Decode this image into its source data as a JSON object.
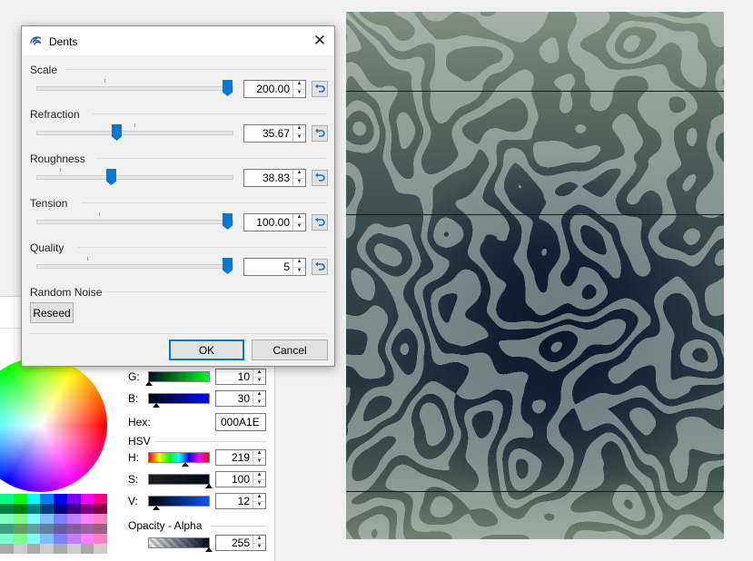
{
  "dialog": {
    "title": "Dents",
    "close_glyph": "✕",
    "params": [
      {
        "label": "Scale",
        "value": "200.00",
        "level": 1.0
      },
      {
        "label": "Refraction",
        "value": "35.67",
        "level": 0.42
      },
      {
        "label": "Roughness",
        "value": "38.83",
        "level": 0.39
      },
      {
        "label": "Tension",
        "value": "100.00",
        "level": 1.0
      },
      {
        "label": "Quality",
        "value": "5",
        "level": 1.0
      }
    ],
    "random_noise_label": "Random Noise",
    "reseed_label": "Reseed",
    "ok_label": "OK",
    "cancel_label": "Cancel",
    "accent_color": "#0078d7"
  },
  "colors": {
    "g": {
      "label": "G:",
      "value": "10"
    },
    "b": {
      "label": "B:",
      "value": "30"
    },
    "hex": {
      "label": "Hex:",
      "value": "000A1E"
    },
    "hsv_label": "HSV",
    "h": {
      "label": "H:",
      "value": "219"
    },
    "s": {
      "label": "S:",
      "value": "100"
    },
    "v": {
      "label": "V:",
      "value": "12"
    },
    "opacity_label": "Opacity - Alpha",
    "alpha": {
      "value": "255"
    }
  },
  "icons": {
    "app": "dents-effect-icon",
    "reset": "reset-arrow-icon",
    "spin_up": "▲",
    "spin_down": "▼"
  }
}
